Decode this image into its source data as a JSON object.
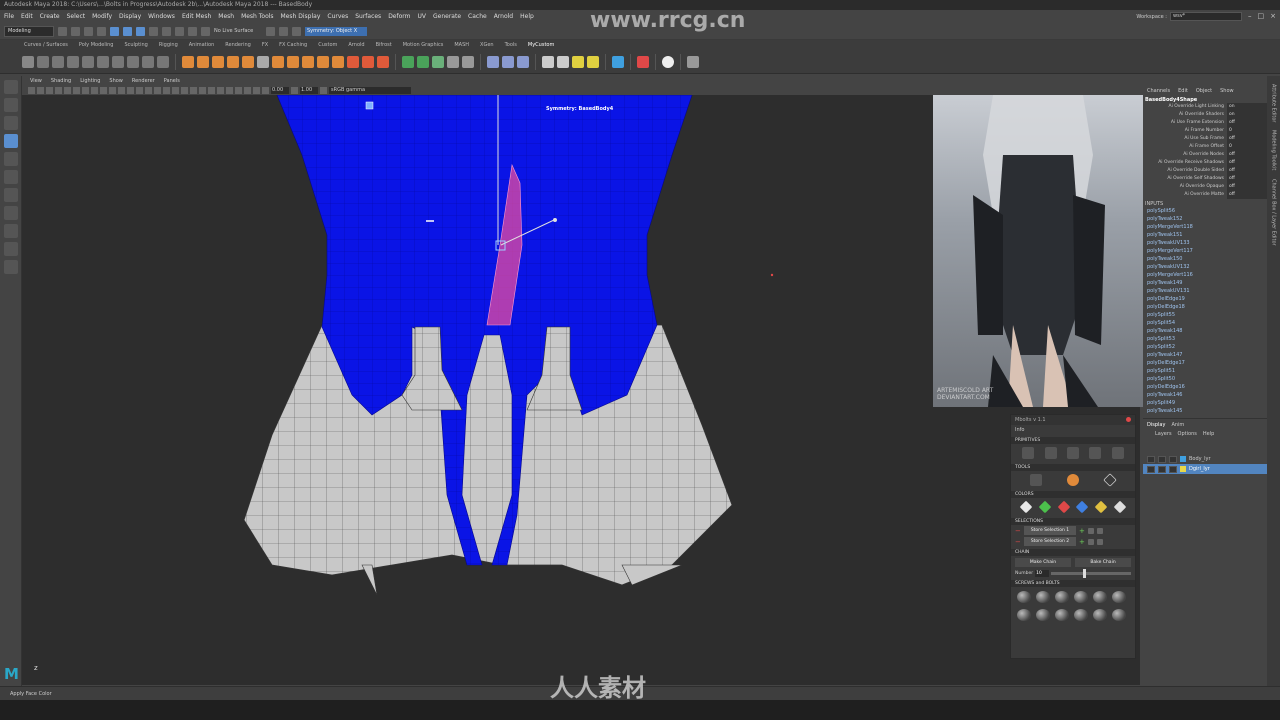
{
  "title_bar": {
    "text": "Autodesk Maya 2018: C:\\Users\\...\\Bolts in Progress\\Autodesk 2b\\...\\Autodesk Maya 2018 --- BasedBody"
  },
  "menu": [
    "File",
    "Edit",
    "Create",
    "Select",
    "Modify",
    "Display",
    "Windows",
    "Edit Mesh",
    "Mesh",
    "Mesh Tools",
    "Mesh Display",
    "Curves",
    "Surfaces",
    "Deform",
    "UV",
    "Generate",
    "Cache",
    "Arnold",
    "Help"
  ],
  "workspace": {
    "label": "Workspace :",
    "value": "wsv*"
  },
  "status_line": {
    "mode": "Modeling",
    "live_surface": "No Live Surface",
    "symmetry": "Symmetry: Object X"
  },
  "shelf_tabs": [
    "Curves / Surfaces",
    "Poly Modeling",
    "Sculpting",
    "Rigging",
    "Animation",
    "Rendering",
    "FX",
    "FX Caching",
    "Custom",
    "Arnold",
    "Bifrost",
    "Motion Graphics",
    "MASH",
    "XGen",
    "Tools",
    "MyCustom"
  ],
  "active_shelf": "MyCustom",
  "panel_menu": [
    "View",
    "Shading",
    "Lighting",
    "Show",
    "Renderer",
    "Panels"
  ],
  "panel_toolbar": {
    "near": "0.00",
    "far": "1.00",
    "color_space": "sRGB gamma"
  },
  "viewport": {
    "symmetry_label": "Symmetry: BasedBody4"
  },
  "reference": {
    "watermark": "ARTEMISCOLD ART\nDEVIANTART.COM"
  },
  "channel_box": {
    "menu": [
      "Channels",
      "Edit",
      "Object",
      "Show"
    ],
    "node": "BasedBody4Shape",
    "attributes": [
      {
        "name": "Ai Override Light Linking",
        "value": "on"
      },
      {
        "name": "Ai Override Shaders",
        "value": "on"
      },
      {
        "name": "Ai Use Frame Extension",
        "value": "off"
      },
      {
        "name": "Ai Frame Number",
        "value": "0"
      },
      {
        "name": "Ai Use Sub Frame",
        "value": "off"
      },
      {
        "name": "Ai Frame Offset",
        "value": "0"
      },
      {
        "name": "Ai Override Nodes",
        "value": "off"
      },
      {
        "name": "Ai Override Receive Shadows",
        "value": "off"
      },
      {
        "name": "Ai Override Double Sided",
        "value": "off"
      },
      {
        "name": "Ai Override Self Shadows",
        "value": "off"
      },
      {
        "name": "Ai Override Opaque",
        "value": "off"
      },
      {
        "name": "Ai Override Matte",
        "value": "off"
      }
    ],
    "inputs_label": "INPUTS",
    "inputs": [
      "polySplit56",
      "polyTweak152",
      "polyMergeVert118",
      "polyTweak151",
      "polyTweakUV133",
      "polyMergeVert117",
      "polyTweak150",
      "polyTweakUV132",
      "polyMergeVert116",
      "polyTweak149",
      "polyTweakUV131",
      "polyDelEdge19",
      "polyDelEdge18",
      "polySplit55",
      "polySplit54",
      "polyTweak148",
      "polySplit53",
      "polySplit52",
      "polyTweak147",
      "polyDelEdge17",
      "polySplit51",
      "polySplit50",
      "polyDelEdge16",
      "polyTweak146",
      "polySplit49",
      "polyTweak145"
    ]
  },
  "side_strip": [
    "Attribute Editor",
    "Modeling Toolkit",
    "Channel Box / Layer Editor"
  ],
  "layer_editor": {
    "tabs": [
      "Display",
      "Anim"
    ],
    "menu": [
      "Layers",
      "Options",
      "Help"
    ],
    "layers": [
      {
        "name": "Body_lyr",
        "color": "#3fa0e0",
        "selected": false
      },
      {
        "name": "Dgirl_lyr",
        "color": "#e8d84a",
        "selected": true
      }
    ]
  },
  "mbolts": {
    "title": "Mbolts v 1.1",
    "info": "Info",
    "sections": {
      "primitives": "PRIMITIVES",
      "tools": "TOOLS",
      "colors": "COLORS",
      "selections": "SELECTIONS",
      "chain": "CHAIN",
      "screws": "SCREWS and BOLTS"
    },
    "color_swatches": [
      "#e8e8e8",
      "#4cc04c",
      "#e04848",
      "#3f7fe0",
      "#e0c040",
      "#dddddd"
    ],
    "selection_buttons": [
      "Store Selection 1",
      "Store Selection 2"
    ],
    "chain_buttons": [
      "Make Chain",
      "Bake Chain"
    ],
    "number_label": "Number",
    "number_value": "10"
  },
  "help_line": {
    "text": "Apply Face Color"
  },
  "watermarks": {
    "top": "www.rrcg.cn",
    "bottom": "人人素材"
  }
}
